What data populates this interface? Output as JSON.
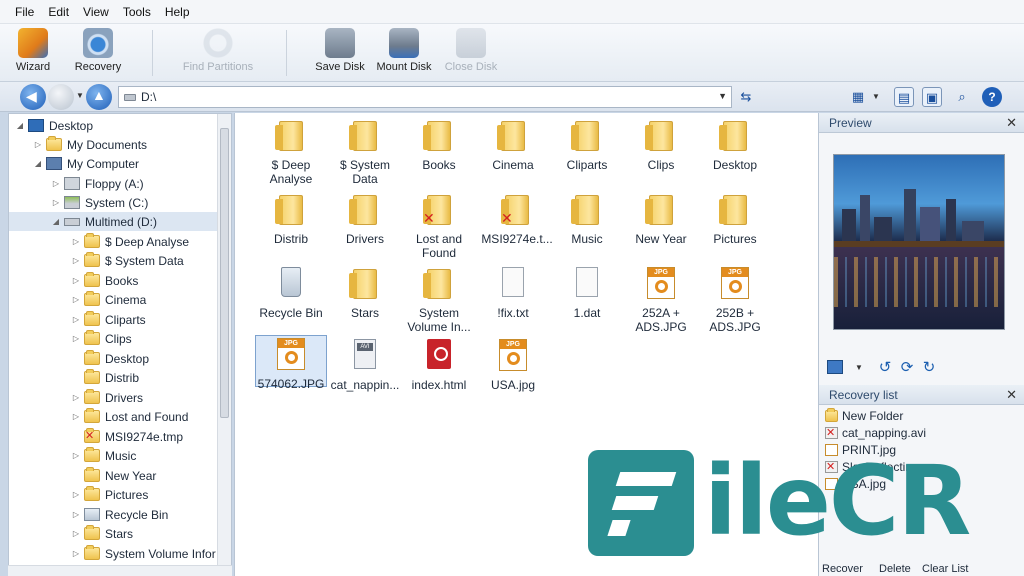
{
  "menu": [
    "File",
    "Edit",
    "View",
    "Tools",
    "Help"
  ],
  "toolbar": {
    "wizard": "Wizard",
    "recovery": "Recovery",
    "find_partitions": "Find Partitions",
    "save_disk": "Save Disk",
    "mount_disk": "Mount Disk",
    "close_disk": "Close Disk"
  },
  "address": {
    "path": "D:\\"
  },
  "tree": [
    {
      "label": "Desktop",
      "icon": "desktop-icon"
    },
    {
      "label": "My Documents",
      "icon": "documents-icon"
    },
    {
      "label": "My Computer",
      "icon": "computer-icon"
    },
    {
      "label": "Floppy (A:)",
      "icon": "floppy-icon"
    },
    {
      "label": "System (C:)",
      "icon": "drive-icon"
    },
    {
      "label": "Multimed (D:)",
      "icon": "drive-icon"
    },
    {
      "label": "$ Deep Analyse",
      "icon": "folder-icon"
    },
    {
      "label": "$ System Data",
      "icon": "folder-icon"
    },
    {
      "label": "Books",
      "icon": "folder-icon"
    },
    {
      "label": "Cinema",
      "icon": "folder-icon"
    },
    {
      "label": "Cliparts",
      "icon": "folder-icon"
    },
    {
      "label": "Clips",
      "icon": "folder-icon"
    },
    {
      "label": "Desktop",
      "icon": "folder-icon"
    },
    {
      "label": "Distrib",
      "icon": "folder-icon"
    },
    {
      "label": "Drivers",
      "icon": "folder-icon"
    },
    {
      "label": "Lost and Found",
      "icon": "folder-icon"
    },
    {
      "label": "MSI9274e.tmp",
      "icon": "deleted-folder-icon"
    },
    {
      "label": "Music",
      "icon": "folder-icon"
    },
    {
      "label": "New Year",
      "icon": "folder-icon"
    },
    {
      "label": "Pictures",
      "icon": "folder-icon"
    },
    {
      "label": "Recycle Bin",
      "icon": "recycle-bin-icon"
    },
    {
      "label": "Stars",
      "icon": "folder-icon"
    },
    {
      "label": "System Volume Infor",
      "icon": "folder-icon"
    }
  ],
  "files": [
    {
      "name": "$ Deep\nAnalyse",
      "type": "folder"
    },
    {
      "name": "$ System\nData",
      "type": "folder"
    },
    {
      "name": "Books",
      "type": "folder"
    },
    {
      "name": "Cinema",
      "type": "folder"
    },
    {
      "name": "Cliparts",
      "type": "folder"
    },
    {
      "name": "Clips",
      "type": "folder"
    },
    {
      "name": "Desktop",
      "type": "folder"
    },
    {
      "name": "Distrib",
      "type": "folder"
    },
    {
      "name": "Drivers",
      "type": "folder"
    },
    {
      "name": "Lost and\nFound",
      "type": "deleted-folder"
    },
    {
      "name": "MSI9274e.t...",
      "type": "deleted-folder"
    },
    {
      "name": "Music",
      "type": "folder"
    },
    {
      "name": "New Year",
      "type": "folder"
    },
    {
      "name": "Pictures",
      "type": "folder"
    },
    {
      "name": "Recycle Bin",
      "type": "recycle-bin"
    },
    {
      "name": "Stars",
      "type": "folder"
    },
    {
      "name": "System\nVolume In...",
      "type": "folder"
    },
    {
      "name": "!fix.txt",
      "type": "doc"
    },
    {
      "name": "1.dat",
      "type": "doc"
    },
    {
      "name": "252A +\nADS.JPG",
      "type": "jpg"
    },
    {
      "name": "252B +\nADS.JPG",
      "type": "jpg"
    },
    {
      "name": "574062.JPG",
      "type": "jpg"
    },
    {
      "name": "cat_nappin...",
      "type": "avi"
    },
    {
      "name": "index.html",
      "type": "html"
    },
    {
      "name": "USA.jpg",
      "type": "jpg"
    }
  ],
  "preview": {
    "title": "Preview",
    "close": "✕"
  },
  "recovery_list": {
    "title": "Recovery list",
    "close": "✕",
    "items": [
      {
        "label": "New Folder",
        "icon": "folder-icon"
      },
      {
        "label": "cat_napping.avi",
        "icon": "deleted-file-icon"
      },
      {
        "label": "PRINT.jpg",
        "icon": "jpg-icon"
      },
      {
        "label": "Sky Reflecting",
        "icon": "deleted-file-icon"
      },
      {
        "label": "USA.jpg",
        "icon": "jpg-icon"
      }
    ],
    "recover": "Recover",
    "delete": "Delete",
    "clear": "Clear List"
  },
  "watermark": {
    "brand": "FileCR",
    "shown_text": "ileCR"
  },
  "colors": {
    "accent": "#2b8e91",
    "selection": "#dbe8f8",
    "folder": "#f5d26a"
  }
}
